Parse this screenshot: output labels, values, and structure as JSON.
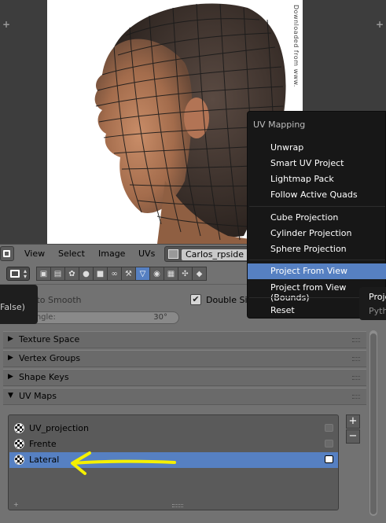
{
  "header": {
    "menus": [
      "View",
      "Select",
      "Image",
      "UVs"
    ],
    "image_name": "Carlos_rpside"
  },
  "watermark_text": "Downloaded from www.",
  "tooltip": {
    "text": "False)"
  },
  "mesh_settings": {
    "auto_smooth_label": "Auto Smooth",
    "double_sided_label": "Double Sic",
    "angle_label": "Angle:",
    "angle_value": "30°",
    "double_sided_checked": "✔"
  },
  "panels": [
    {
      "label": "Texture Space",
      "arrow": "▶"
    },
    {
      "label": "Vertex Groups",
      "arrow": "▶"
    },
    {
      "label": "Shape Keys",
      "arrow": "▶"
    },
    {
      "label": "UV Maps",
      "arrow": "▼"
    }
  ],
  "uv_maps": {
    "items": [
      {
        "name": "UV_projection",
        "selected": false
      },
      {
        "name": "Frente",
        "selected": false
      },
      {
        "name": "Lateral",
        "selected": true
      }
    ],
    "add_label": "+",
    "remove_label": "−"
  },
  "uv_menu": {
    "title": "UV Mapping",
    "items": [
      {
        "label": "Unwrap"
      },
      {
        "label": "Smart UV Project"
      },
      {
        "label": "Lightmap Pack"
      },
      {
        "label": "Follow Active Quads"
      },
      {
        "label": "Cube Projection"
      },
      {
        "label": "Cylinder Projection"
      },
      {
        "label": "Sphere Projection"
      },
      {
        "label": "Project From View",
        "active": true
      },
      {
        "label": "Project from View (Bounds)"
      },
      {
        "label": "Reset"
      }
    ]
  },
  "submenu": {
    "line1": "Proje",
    "line2": "Pyth"
  },
  "colors": {
    "selection_blue": "#5680c2",
    "annotation_arrow": "#f5f000",
    "panel_bg": "#727272",
    "menu_bg": "#171717"
  }
}
